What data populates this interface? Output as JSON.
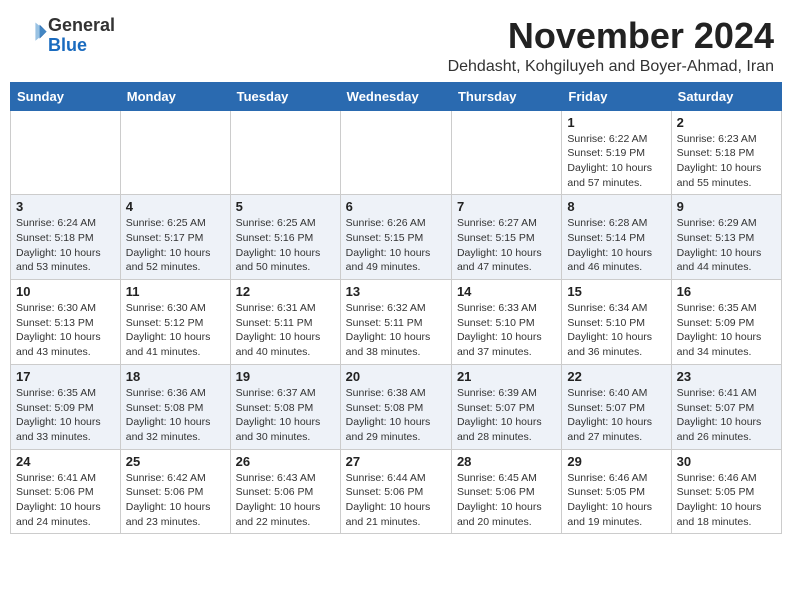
{
  "header": {
    "logo_line1": "General",
    "logo_line2": "Blue",
    "month_title": "November 2024",
    "subtitle": "Dehdasht, Kohgiluyeh and Boyer-Ahmad, Iran"
  },
  "days_of_week": [
    "Sunday",
    "Monday",
    "Tuesday",
    "Wednesday",
    "Thursday",
    "Friday",
    "Saturday"
  ],
  "weeks": [
    [
      {
        "day": "",
        "info": ""
      },
      {
        "day": "",
        "info": ""
      },
      {
        "day": "",
        "info": ""
      },
      {
        "day": "",
        "info": ""
      },
      {
        "day": "",
        "info": ""
      },
      {
        "day": "1",
        "info": "Sunrise: 6:22 AM\nSunset: 5:19 PM\nDaylight: 10 hours and 57 minutes."
      },
      {
        "day": "2",
        "info": "Sunrise: 6:23 AM\nSunset: 5:18 PM\nDaylight: 10 hours and 55 minutes."
      }
    ],
    [
      {
        "day": "3",
        "info": "Sunrise: 6:24 AM\nSunset: 5:18 PM\nDaylight: 10 hours and 53 minutes."
      },
      {
        "day": "4",
        "info": "Sunrise: 6:25 AM\nSunset: 5:17 PM\nDaylight: 10 hours and 52 minutes."
      },
      {
        "day": "5",
        "info": "Sunrise: 6:25 AM\nSunset: 5:16 PM\nDaylight: 10 hours and 50 minutes."
      },
      {
        "day": "6",
        "info": "Sunrise: 6:26 AM\nSunset: 5:15 PM\nDaylight: 10 hours and 49 minutes."
      },
      {
        "day": "7",
        "info": "Sunrise: 6:27 AM\nSunset: 5:15 PM\nDaylight: 10 hours and 47 minutes."
      },
      {
        "day": "8",
        "info": "Sunrise: 6:28 AM\nSunset: 5:14 PM\nDaylight: 10 hours and 46 minutes."
      },
      {
        "day": "9",
        "info": "Sunrise: 6:29 AM\nSunset: 5:13 PM\nDaylight: 10 hours and 44 minutes."
      }
    ],
    [
      {
        "day": "10",
        "info": "Sunrise: 6:30 AM\nSunset: 5:13 PM\nDaylight: 10 hours and 43 minutes."
      },
      {
        "day": "11",
        "info": "Sunrise: 6:30 AM\nSunset: 5:12 PM\nDaylight: 10 hours and 41 minutes."
      },
      {
        "day": "12",
        "info": "Sunrise: 6:31 AM\nSunset: 5:11 PM\nDaylight: 10 hours and 40 minutes."
      },
      {
        "day": "13",
        "info": "Sunrise: 6:32 AM\nSunset: 5:11 PM\nDaylight: 10 hours and 38 minutes."
      },
      {
        "day": "14",
        "info": "Sunrise: 6:33 AM\nSunset: 5:10 PM\nDaylight: 10 hours and 37 minutes."
      },
      {
        "day": "15",
        "info": "Sunrise: 6:34 AM\nSunset: 5:10 PM\nDaylight: 10 hours and 36 minutes."
      },
      {
        "day": "16",
        "info": "Sunrise: 6:35 AM\nSunset: 5:09 PM\nDaylight: 10 hours and 34 minutes."
      }
    ],
    [
      {
        "day": "17",
        "info": "Sunrise: 6:35 AM\nSunset: 5:09 PM\nDaylight: 10 hours and 33 minutes."
      },
      {
        "day": "18",
        "info": "Sunrise: 6:36 AM\nSunset: 5:08 PM\nDaylight: 10 hours and 32 minutes."
      },
      {
        "day": "19",
        "info": "Sunrise: 6:37 AM\nSunset: 5:08 PM\nDaylight: 10 hours and 30 minutes."
      },
      {
        "day": "20",
        "info": "Sunrise: 6:38 AM\nSunset: 5:08 PM\nDaylight: 10 hours and 29 minutes."
      },
      {
        "day": "21",
        "info": "Sunrise: 6:39 AM\nSunset: 5:07 PM\nDaylight: 10 hours and 28 minutes."
      },
      {
        "day": "22",
        "info": "Sunrise: 6:40 AM\nSunset: 5:07 PM\nDaylight: 10 hours and 27 minutes."
      },
      {
        "day": "23",
        "info": "Sunrise: 6:41 AM\nSunset: 5:07 PM\nDaylight: 10 hours and 26 minutes."
      }
    ],
    [
      {
        "day": "24",
        "info": "Sunrise: 6:41 AM\nSunset: 5:06 PM\nDaylight: 10 hours and 24 minutes."
      },
      {
        "day": "25",
        "info": "Sunrise: 6:42 AM\nSunset: 5:06 PM\nDaylight: 10 hours and 23 minutes."
      },
      {
        "day": "26",
        "info": "Sunrise: 6:43 AM\nSunset: 5:06 PM\nDaylight: 10 hours and 22 minutes."
      },
      {
        "day": "27",
        "info": "Sunrise: 6:44 AM\nSunset: 5:06 PM\nDaylight: 10 hours and 21 minutes."
      },
      {
        "day": "28",
        "info": "Sunrise: 6:45 AM\nSunset: 5:06 PM\nDaylight: 10 hours and 20 minutes."
      },
      {
        "day": "29",
        "info": "Sunrise: 6:46 AM\nSunset: 5:05 PM\nDaylight: 10 hours and 19 minutes."
      },
      {
        "day": "30",
        "info": "Sunrise: 6:46 AM\nSunset: 5:05 PM\nDaylight: 10 hours and 18 minutes."
      }
    ]
  ]
}
